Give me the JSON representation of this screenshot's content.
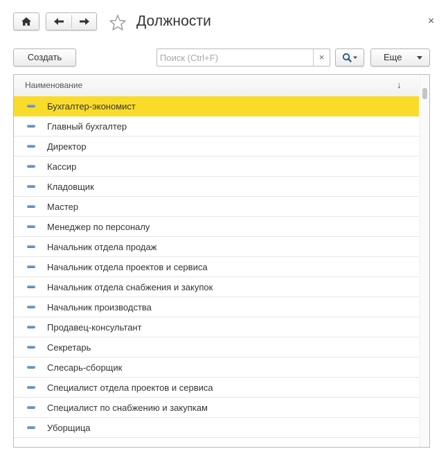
{
  "window": {
    "title": "Должности",
    "close_glyph": "×"
  },
  "toolbar": {
    "create_label": "Создать",
    "more_label": "Еще",
    "search": {
      "placeholder": "Поиск (Ctrl+F)",
      "value": "",
      "clear_glyph": "×"
    }
  },
  "icons": {
    "home": "home-icon",
    "back": "arrow-left-icon",
    "forward": "arrow-right-icon",
    "favorite": "star-icon",
    "search": "magnifier-icon",
    "item": "catalog-item-icon"
  },
  "table": {
    "column_header": "Наименование",
    "sort_glyph": "↓",
    "selected_index": 0,
    "rows": [
      "Бухгалтер-экономист",
      "Главный бухгалтер",
      "Директор",
      "Кассир",
      "Кладовщик",
      "Мастер",
      "Менеджер по персоналу",
      "Начальник отдела продаж",
      "Начальник отдела проектов и сервиса",
      "Начальник отдела снабжения и закупок",
      "Начальник производства",
      "Продавец-консультант",
      "Секретарь",
      "Слесарь-сборщик",
      "Специалист отдела проектов и сервиса",
      "Специалист по снабжению и закупкам",
      "Уборщица"
    ]
  },
  "colors": {
    "selection": "#f9dc2a",
    "item_icon": "#5b88b8"
  }
}
